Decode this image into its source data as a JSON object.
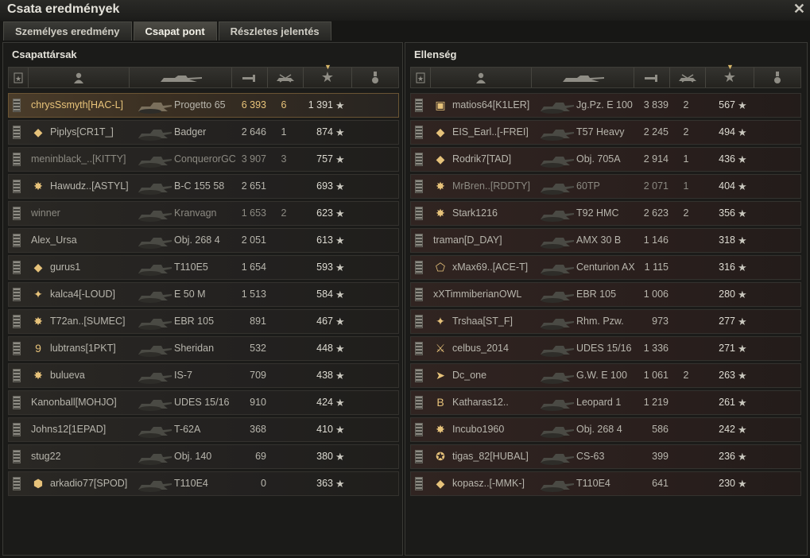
{
  "window": {
    "title": "Csata eredmények",
    "close_icon": "close-icon"
  },
  "tabs": [
    {
      "label": "Személyes eredmény",
      "active": false
    },
    {
      "label": "Csapat pont",
      "active": true
    },
    {
      "label": "Részletes jelentés",
      "active": false
    }
  ],
  "columns": [
    "badge-icon",
    "player-icon",
    "tank-icon",
    "damage-icon",
    "kills-icon",
    "xp-star-icon",
    "medal-icon"
  ],
  "star_glyph": "★",
  "allies": {
    "title": "Csapattársak",
    "rows": [
      {
        "name": "chrysSsmyth[HAC-L]",
        "tank": "Progetto 65",
        "damage": "6 393",
        "kills": "6",
        "xp": "1 391",
        "mark": "",
        "style": "mine"
      },
      {
        "name": "Piplys[CR1T_]",
        "tank": "Badger",
        "damage": "2 646",
        "kills": "1",
        "xp": "874",
        "mark": "◆",
        "style": ""
      },
      {
        "name": "meninblack_..[KITTY]",
        "tank": "ConquerorGC",
        "damage": "3 907",
        "kills": "3",
        "xp": "757",
        "mark": "",
        "style": "grey"
      },
      {
        "name": "Hawudz..[ASTYL]",
        "tank": "B-C 155 58",
        "damage": "2 651",
        "kills": "",
        "xp": "693",
        "mark": "✸",
        "style": ""
      },
      {
        "name": "winner",
        "tank": "Kranvagn",
        "damage": "1 653",
        "kills": "2",
        "xp": "623",
        "mark": "",
        "style": "grey"
      },
      {
        "name": "Alex_Ursa",
        "tank": "Obj. 268 4",
        "damage": "2 051",
        "kills": "",
        "xp": "613",
        "mark": "",
        "style": ""
      },
      {
        "name": "gurus1",
        "tank": "T110E5",
        "damage": "1 654",
        "kills": "",
        "xp": "593",
        "mark": "◆",
        "style": ""
      },
      {
        "name": "kalca4[-LOUD]",
        "tank": "E 50 M",
        "damage": "1 513",
        "kills": "",
        "xp": "584",
        "mark": "✦",
        "style": ""
      },
      {
        "name": "T72an..[SUMEC]",
        "tank": "EBR 105",
        "damage": "891",
        "kills": "",
        "xp": "467",
        "mark": "✸",
        "style": ""
      },
      {
        "name": "lubtrans[1PKT]",
        "tank": "Sheridan",
        "damage": "532",
        "kills": "",
        "xp": "448",
        "mark": "9",
        "style": ""
      },
      {
        "name": "bulueva",
        "tank": "IS-7",
        "damage": "709",
        "kills": "",
        "xp": "438",
        "mark": "✸",
        "style": ""
      },
      {
        "name": "Kanonball[MOHJO]",
        "tank": "UDES 15/16",
        "damage": "910",
        "kills": "",
        "xp": "424",
        "mark": "",
        "style": ""
      },
      {
        "name": "Johns12[1EPAD]",
        "tank": "T-62A",
        "damage": "368",
        "kills": "",
        "xp": "410",
        "mark": "",
        "style": ""
      },
      {
        "name": "stug22",
        "tank": "Obj. 140",
        "damage": "69",
        "kills": "",
        "xp": "380",
        "mark": "",
        "style": ""
      },
      {
        "name": "arkadio77[SPOD]",
        "tank": "T110E4",
        "damage": "0",
        "kills": "",
        "xp": "363",
        "mark": "⬢",
        "style": ""
      }
    ]
  },
  "enemies": {
    "title": "Ellenség",
    "rows": [
      {
        "name": "matios64[K1LER]",
        "tank": "Jg.Pz. E 100",
        "damage": "3 839",
        "kills": "2",
        "xp": "567",
        "mark": "▣",
        "style": "red"
      },
      {
        "name": "EIS_Earl..[-FREI]",
        "tank": "T57 Heavy",
        "damage": "2 245",
        "kills": "2",
        "xp": "494",
        "mark": "◆",
        "style": "red"
      },
      {
        "name": "Rodrik7[TAD]",
        "tank": "Obj. 705A",
        "damage": "2 914",
        "kills": "1",
        "xp": "436",
        "mark": "◆",
        "style": "red"
      },
      {
        "name": "MrBren..[RDDTY]",
        "tank": "60TP",
        "damage": "2 071",
        "kills": "1",
        "xp": "404",
        "mark": "✸",
        "style": "red grey"
      },
      {
        "name": "Stark1216",
        "tank": "T92 HMC",
        "damage": "2 623",
        "kills": "2",
        "xp": "356",
        "mark": "✸",
        "style": "red"
      },
      {
        "name": "traman[D_DAY]",
        "tank": "AMX 30 B",
        "damage": "1 146",
        "kills": "",
        "xp": "318",
        "mark": "",
        "style": "red"
      },
      {
        "name": "xMax69..[ACE-T]",
        "tank": "Centurion AX",
        "damage": "1 115",
        "kills": "",
        "xp": "316",
        "mark": "⬠",
        "style": "red"
      },
      {
        "name": "xXTimmiberianOWL",
        "tank": "EBR 105",
        "damage": "1 006",
        "kills": "",
        "xp": "280",
        "mark": "",
        "style": "red"
      },
      {
        "name": "Trshaa[ST_F]",
        "tank": "Rhm. Pzw.",
        "damage": "973",
        "kills": "",
        "xp": "277",
        "mark": "✦",
        "style": "red"
      },
      {
        "name": "celbus_2014",
        "tank": "UDES 15/16",
        "damage": "1 336",
        "kills": "",
        "xp": "271",
        "mark": "⚔",
        "style": "red"
      },
      {
        "name": "Dc_one",
        "tank": "G.W. E 100",
        "damage": "1 061",
        "kills": "2",
        "xp": "263",
        "mark": "➤",
        "style": "red"
      },
      {
        "name": "Katharas12..",
        "tank": "Leopard 1",
        "damage": "1 219",
        "kills": "",
        "xp": "261",
        "mark": "B",
        "style": "red"
      },
      {
        "name": "Incubo1960",
        "tank": "Obj. 268 4",
        "damage": "586",
        "kills": "",
        "xp": "242",
        "mark": "✸",
        "style": "red"
      },
      {
        "name": "tigas_82[HUBAL]",
        "tank": "CS-63",
        "damage": "399",
        "kills": "",
        "xp": "236",
        "mark": "✪",
        "style": "red"
      },
      {
        "name": "kopasz..[-MMK-]",
        "tank": "T110E4",
        "damage": "641",
        "kills": "",
        "xp": "230",
        "mark": "◆",
        "style": "red"
      }
    ]
  }
}
